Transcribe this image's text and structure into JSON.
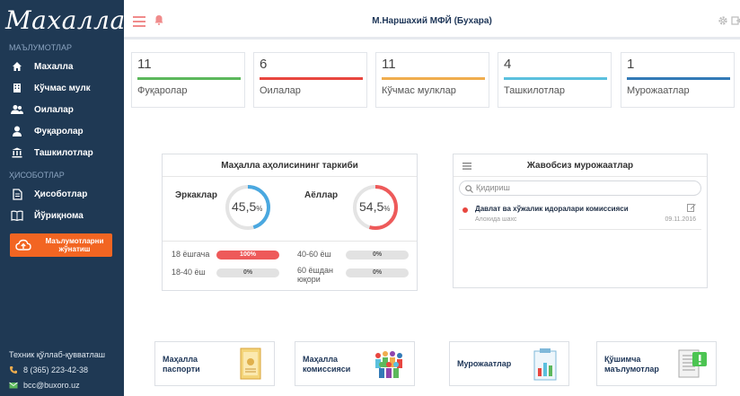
{
  "logo": "Махалла",
  "sidebar": {
    "section1": "МАЪЛУМОТЛАР",
    "items": [
      {
        "label": "Махалла"
      },
      {
        "label": "Кўчмас мулк"
      },
      {
        "label": "Оилалар"
      },
      {
        "label": "Фуқаролар"
      },
      {
        "label": "Ташкилотлар"
      }
    ],
    "section2": "ҲИСОБОТЛАР",
    "items2": [
      {
        "label": "Ҳисоботлар"
      },
      {
        "label": "Йўриқнома"
      }
    ],
    "send_button": "Маълумотларни жўнатиш",
    "footer": {
      "support": "Техник қўллаб-қувватлаш",
      "phone": "8 (365) 223-42-38",
      "email": "bcc@buxoro.uz"
    }
  },
  "header": {
    "title": "М.Наршахий МФЙ (Бухара)"
  },
  "stats": [
    {
      "value": "11",
      "label": "Фуқаролар",
      "color": "#5cb85c"
    },
    {
      "value": "6",
      "label": "Оилалар",
      "color": "#e8463f"
    },
    {
      "value": "11",
      "label": "Кўчмас мулклар",
      "color": "#f0ad4e"
    },
    {
      "value": "4",
      "label": "Ташкилотлар",
      "color": "#5bc0de"
    },
    {
      "value": "1",
      "label": "Мурожаатлар",
      "color": "#337ab7"
    }
  ],
  "population": {
    "title": "Маҳалла аҳолисининг таркиби",
    "men_label": "Эркаклар",
    "men_value": "45,5",
    "men_percent": 45.5,
    "men_color": "#4aa8e0",
    "women_label": "Аёллар",
    "women_value": "54,5",
    "women_percent": 54.5,
    "women_color": "#ee5a5a",
    "percent_sign": "%",
    "ages": [
      {
        "label": "18 ёшгача",
        "value": "100%"
      },
      {
        "label": "18-40 ёш",
        "value": "0%"
      },
      {
        "label": "40-60 ёш",
        "value": "0%"
      },
      {
        "label": "60 ёшдан юқори",
        "value": "0%"
      }
    ]
  },
  "unanswered": {
    "title": "Жавобсиз мурожаатлар",
    "search_placeholder": "Қидириш",
    "item": {
      "title": "Давлат ва хўжалик идоралари комиссияси",
      "subtitle": "Алохида шахс",
      "date": "09.11.2016"
    }
  },
  "tiles": [
    {
      "label": "Маҳалла паспорти"
    },
    {
      "label": "Маҳалла комиссияси"
    },
    {
      "label": "Мурожаатлар"
    },
    {
      "label": "Қўшимча маълумотлар"
    }
  ]
}
